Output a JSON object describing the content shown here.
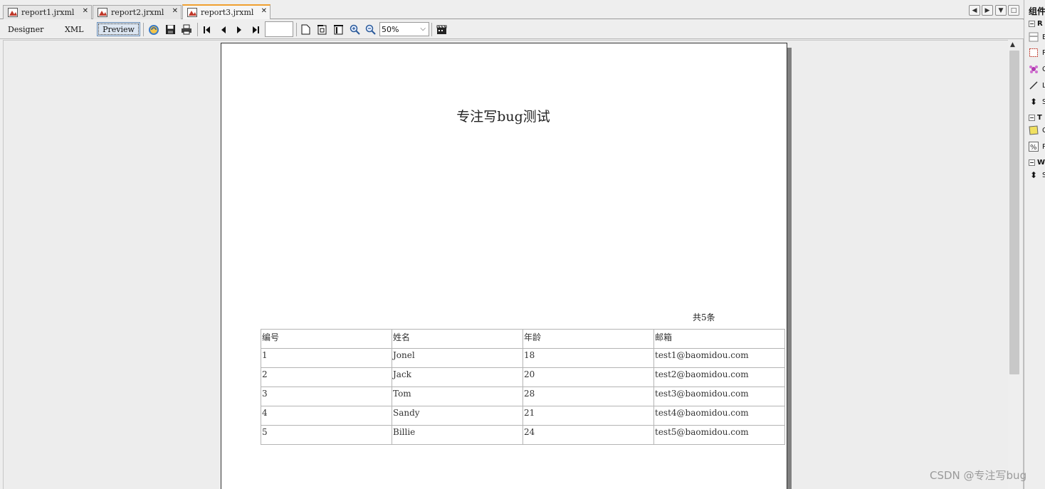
{
  "tabs": [
    {
      "label": "report1.jrxml",
      "active": false
    },
    {
      "label": "report2.jrxml",
      "active": false
    },
    {
      "label": "report3.jrxml",
      "active": true
    }
  ],
  "toolbar": {
    "designer_label": "Designer",
    "xml_label": "XML",
    "preview_label": "Preview",
    "page_number": "",
    "zoom": "50%"
  },
  "report": {
    "title": "专注写bug测试",
    "count": "共5条",
    "columns": [
      "编号",
      "姓名",
      "年龄",
      "邮箱"
    ],
    "rows": [
      [
        "1",
        "Jonel",
        "18",
        "test1@baomidou.com"
      ],
      [
        "2",
        "Jack",
        "20",
        "test2@baomidou.com"
      ],
      [
        "3",
        "Tom",
        "28",
        "test3@baomidou.com"
      ],
      [
        "4",
        "Sandy",
        "21",
        "test4@baomidou.com"
      ],
      [
        "5",
        "Billie",
        "24",
        "test5@baomidou.com"
      ]
    ]
  },
  "palette": {
    "title": "组件",
    "sections": [
      "R",
      "T",
      "W"
    ],
    "items": [
      "B",
      "R",
      "C",
      "L",
      "S",
      "C",
      "P",
      "S"
    ]
  },
  "watermark": "CSDN @专注写bug",
  "colors": {
    "active_tab_accent": "#f0a030",
    "page_bg": "#ffffff",
    "workspace_bg": "#ededed"
  }
}
